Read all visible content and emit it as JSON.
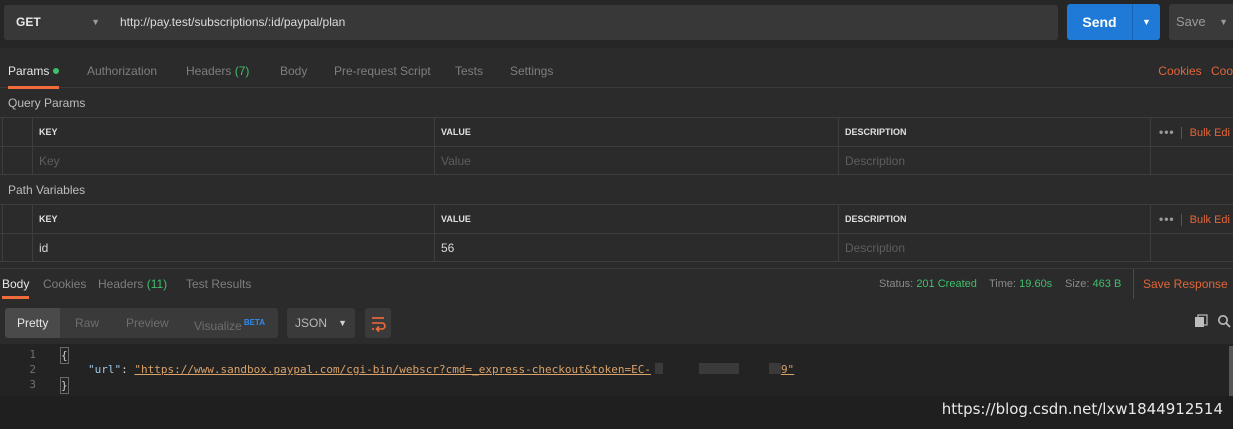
{
  "request": {
    "method": "GET",
    "url": "http://pay.test/subscriptions/:id/paypal/plan",
    "send_label": "Send",
    "save_label": "Save"
  },
  "request_tabs": {
    "params": "Params",
    "authorization": "Authorization",
    "headers": "Headers",
    "headers_count": "(7)",
    "body": "Body",
    "pre_request": "Pre-request Script",
    "tests": "Tests",
    "settings": "Settings",
    "cookies": "Cookies",
    "code": "Coo"
  },
  "query_params": {
    "title": "Query Params",
    "columns": [
      "KEY",
      "VALUE",
      "DESCRIPTION"
    ],
    "bulk_edit": "Bulk Edi",
    "dots": "•••",
    "placeholder": {
      "key": "Key",
      "value": "Value",
      "description": "Description"
    }
  },
  "path_variables": {
    "title": "Path Variables",
    "columns": [
      "KEY",
      "VALUE",
      "DESCRIPTION"
    ],
    "bulk_edit": "Bulk Edi",
    "dots": "•••",
    "row": {
      "key": "id",
      "value": "56",
      "description": "Description"
    }
  },
  "response_tabs": {
    "body": "Body",
    "cookies": "Cookies",
    "headers": "Headers",
    "headers_count": "(11)",
    "test_results": "Test Results"
  },
  "response_status": {
    "status_label": "Status:",
    "status_value": "201 Created",
    "time_label": "Time:",
    "time_value": "19.60s",
    "size_label": "Size:",
    "size_value": "463 B",
    "save_response": "Save Response"
  },
  "view_modes": {
    "pretty": "Pretty",
    "raw": "Raw",
    "preview": "Preview",
    "visualize": "Visualize",
    "beta": "BETA",
    "format": "JSON"
  },
  "code": {
    "line_numbers": [
      "1",
      "2",
      "3"
    ],
    "open_brace": "{",
    "close_brace": "}",
    "key": "\"url\"",
    "colon": ": ",
    "url_value": "\"https://www.sandbox.paypal.com/cgi-bin/webscr?cmd=_express-checkout&token=EC-",
    "url_tail": "9\""
  },
  "watermark": "https://blog.csdn.net/lxw1844912514",
  "colors": {
    "accent": "#f26b3a",
    "send": "#1e7ad6",
    "status_ok": "#3fbf6a",
    "link": "#e0663a"
  }
}
